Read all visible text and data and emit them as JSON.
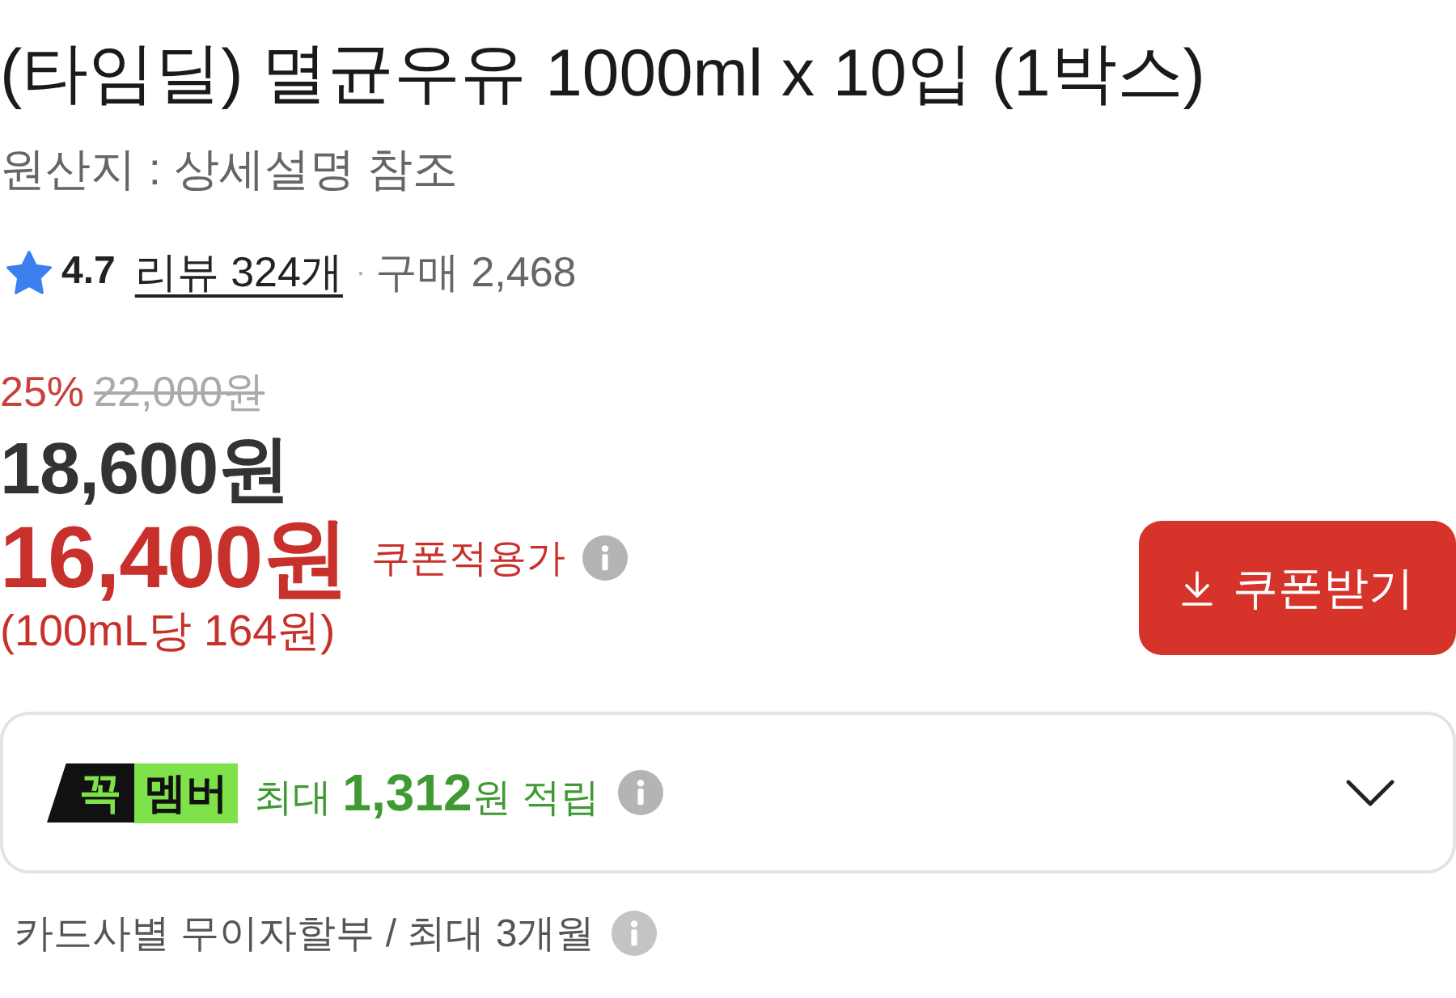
{
  "product": {
    "title": "(타임딜) 멸균우유 1000ml x 10입 (1박스)",
    "origin": "원산지 : 상세설명 참조"
  },
  "rating": {
    "score": "4.7",
    "reviews": "리뷰 324개",
    "separator": "·",
    "purchases": "구매 2,468"
  },
  "price": {
    "discount": "25%",
    "original": "22,000원",
    "sale": "18,600원",
    "coupon_price": "16,400원",
    "coupon_label": "쿠폰적용가",
    "unit_price": "(100mL당 164원)"
  },
  "coupon_button": {
    "label": "쿠폰받기"
  },
  "membership": {
    "badge_mark": "꼭",
    "badge_label": "멤버",
    "text": "최대 **1,312**원 적립",
    "expanded": false
  },
  "installment": {
    "text": "카드사별 무이자할부 / 최대 3개월"
  }
}
